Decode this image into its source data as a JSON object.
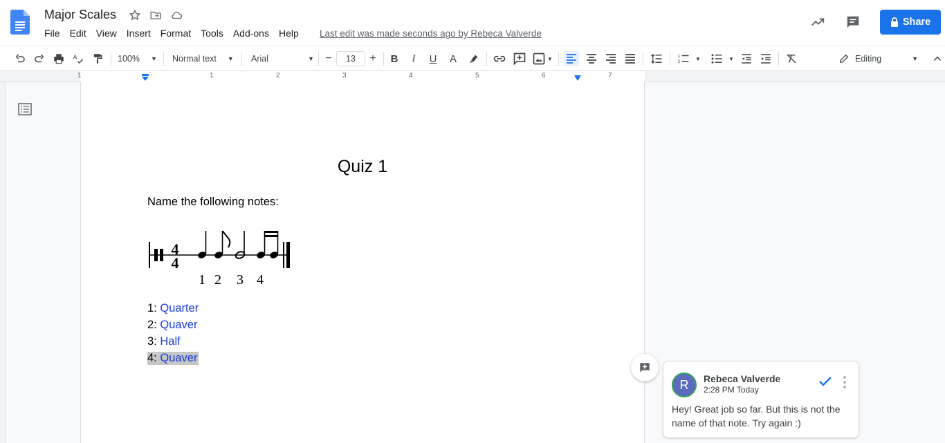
{
  "doc": {
    "title": "Major Scales",
    "last_edit": "Last edit was made seconds ago by Rebeca Valverde"
  },
  "menu": [
    "File",
    "Edit",
    "View",
    "Insert",
    "Format",
    "Tools",
    "Add-ons",
    "Help"
  ],
  "share": {
    "label": "Share"
  },
  "toolbar": {
    "zoom": "100%",
    "style": "Normal text",
    "font": "Arial",
    "font_size": "13",
    "mode": "Editing",
    "icons": [
      "undo-icon",
      "redo-icon",
      "print-icon",
      "spellcheck-icon",
      "paint-format-icon",
      "bold-icon",
      "italic-icon",
      "underline-icon",
      "text-color-icon",
      "highlight-icon",
      "link-icon",
      "add-comment-icon",
      "image-icon",
      "align-left-icon",
      "align-center-icon",
      "align-right-icon",
      "justify-icon",
      "line-spacing-icon",
      "numbered-list-icon",
      "bulleted-list-icon",
      "decrease-indent-icon",
      "increase-indent-icon",
      "clear-formatting-icon",
      "pencil-icon",
      "collapse-icon"
    ]
  },
  "ruler": {
    "labels": [
      "1",
      "1",
      "2",
      "3",
      "4",
      "5",
      "6",
      "7"
    ]
  },
  "page": {
    "title": "Quiz 1",
    "instructions": "Name the following notes:",
    "beat_numbers": [
      "1",
      "2",
      "3",
      "4"
    ],
    "time_signature": {
      "top": "4",
      "bottom": "4"
    },
    "answers": [
      {
        "num": "1:",
        "value": "Quarter"
      },
      {
        "num": "2:",
        "value": "Quaver"
      },
      {
        "num": "3:",
        "value": "Half"
      },
      {
        "num": "4:",
        "value": "Quaver"
      }
    ]
  },
  "comment": {
    "initial": "R",
    "author": "Rebeca Valverde",
    "time": "2:28 PM Today",
    "text": "Hey! Great job so far. But this is not the name of that note. Try again :)"
  },
  "colors": {
    "accent": "#1a73e8",
    "answer_text": "#1a3ed8",
    "highlight": "#c6c6c6",
    "avatar": "#5c6bc0"
  }
}
